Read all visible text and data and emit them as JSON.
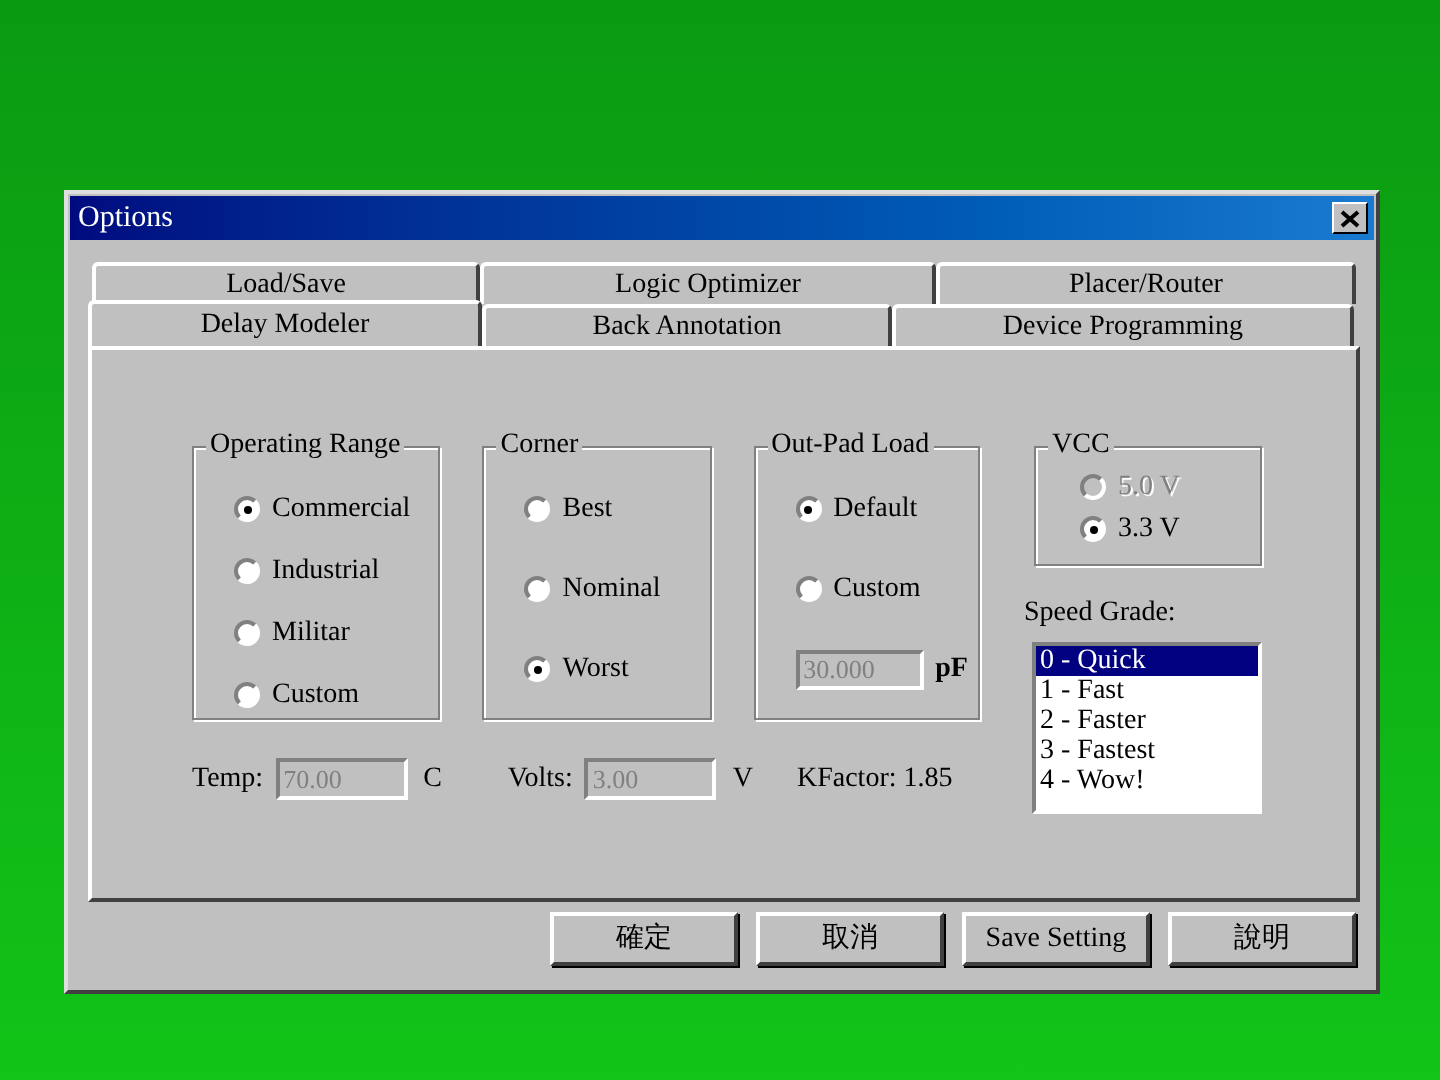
{
  "window": {
    "title": "Options"
  },
  "tab_rows": [
    {
      "tabs": [
        {
          "label": "Load/Save",
          "selected": false
        },
        {
          "label": "Logic Optimizer",
          "selected": false
        },
        {
          "label": "Placer/Router",
          "selected": false
        }
      ]
    },
    {
      "tabs": [
        {
          "label": "Delay Modeler",
          "selected": true
        },
        {
          "label": "Back Annotation",
          "selected": false
        },
        {
          "label": "Device Programming",
          "selected": false
        }
      ]
    }
  ],
  "groups": [
    {
      "title": "Operating Range",
      "options": [
        {
          "label": "Commercial",
          "selected": true,
          "disabled": false
        },
        {
          "label": "Industrial",
          "selected": false,
          "disabled": false
        },
        {
          "label": "Militar",
          "selected": false,
          "disabled": false
        },
        {
          "label": "Custom",
          "selected": false,
          "disabled": false
        }
      ]
    },
    {
      "title": "Corner",
      "options": [
        {
          "label": "Best",
          "selected": false,
          "disabled": false
        },
        {
          "label": "Nominal",
          "selected": false,
          "disabled": false
        },
        {
          "label": "Worst",
          "selected": true,
          "disabled": false
        }
      ]
    },
    {
      "title": "Out-Pad Load",
      "options": [
        {
          "label": "Default",
          "selected": true,
          "disabled": false
        },
        {
          "label": "Custom",
          "selected": false,
          "disabled": false
        }
      ],
      "field": {
        "value": "30.000",
        "unit": "pF",
        "disabled": true
      }
    }
  ],
  "vcc": {
    "title": "VCC",
    "options": [
      {
        "label": "5.0 V",
        "selected": false,
        "disabled": true
      },
      {
        "label": "3.3 V",
        "selected": true,
        "disabled": false
      }
    ]
  },
  "params": [
    {
      "label": "Temp:",
      "value": "70.00",
      "unit": "C",
      "disabled": true
    },
    {
      "label": "Volts:",
      "value": "3.00",
      "unit": "V",
      "disabled": true
    }
  ],
  "kfactor": "KFactor: 1.85",
  "speed_grade": {
    "label": "Speed Grade:",
    "items": [
      {
        "text": "0 - Quick",
        "selected": true
      },
      {
        "text": "1 - Fast",
        "selected": false
      },
      {
        "text": "2 - Faster",
        "selected": false
      },
      {
        "text": "3 - Fastest",
        "selected": false
      },
      {
        "text": "4 - Wow!",
        "selected": false
      }
    ]
  },
  "buttons": [
    "確定",
    "取消",
    "Save Setting",
    "說明"
  ]
}
